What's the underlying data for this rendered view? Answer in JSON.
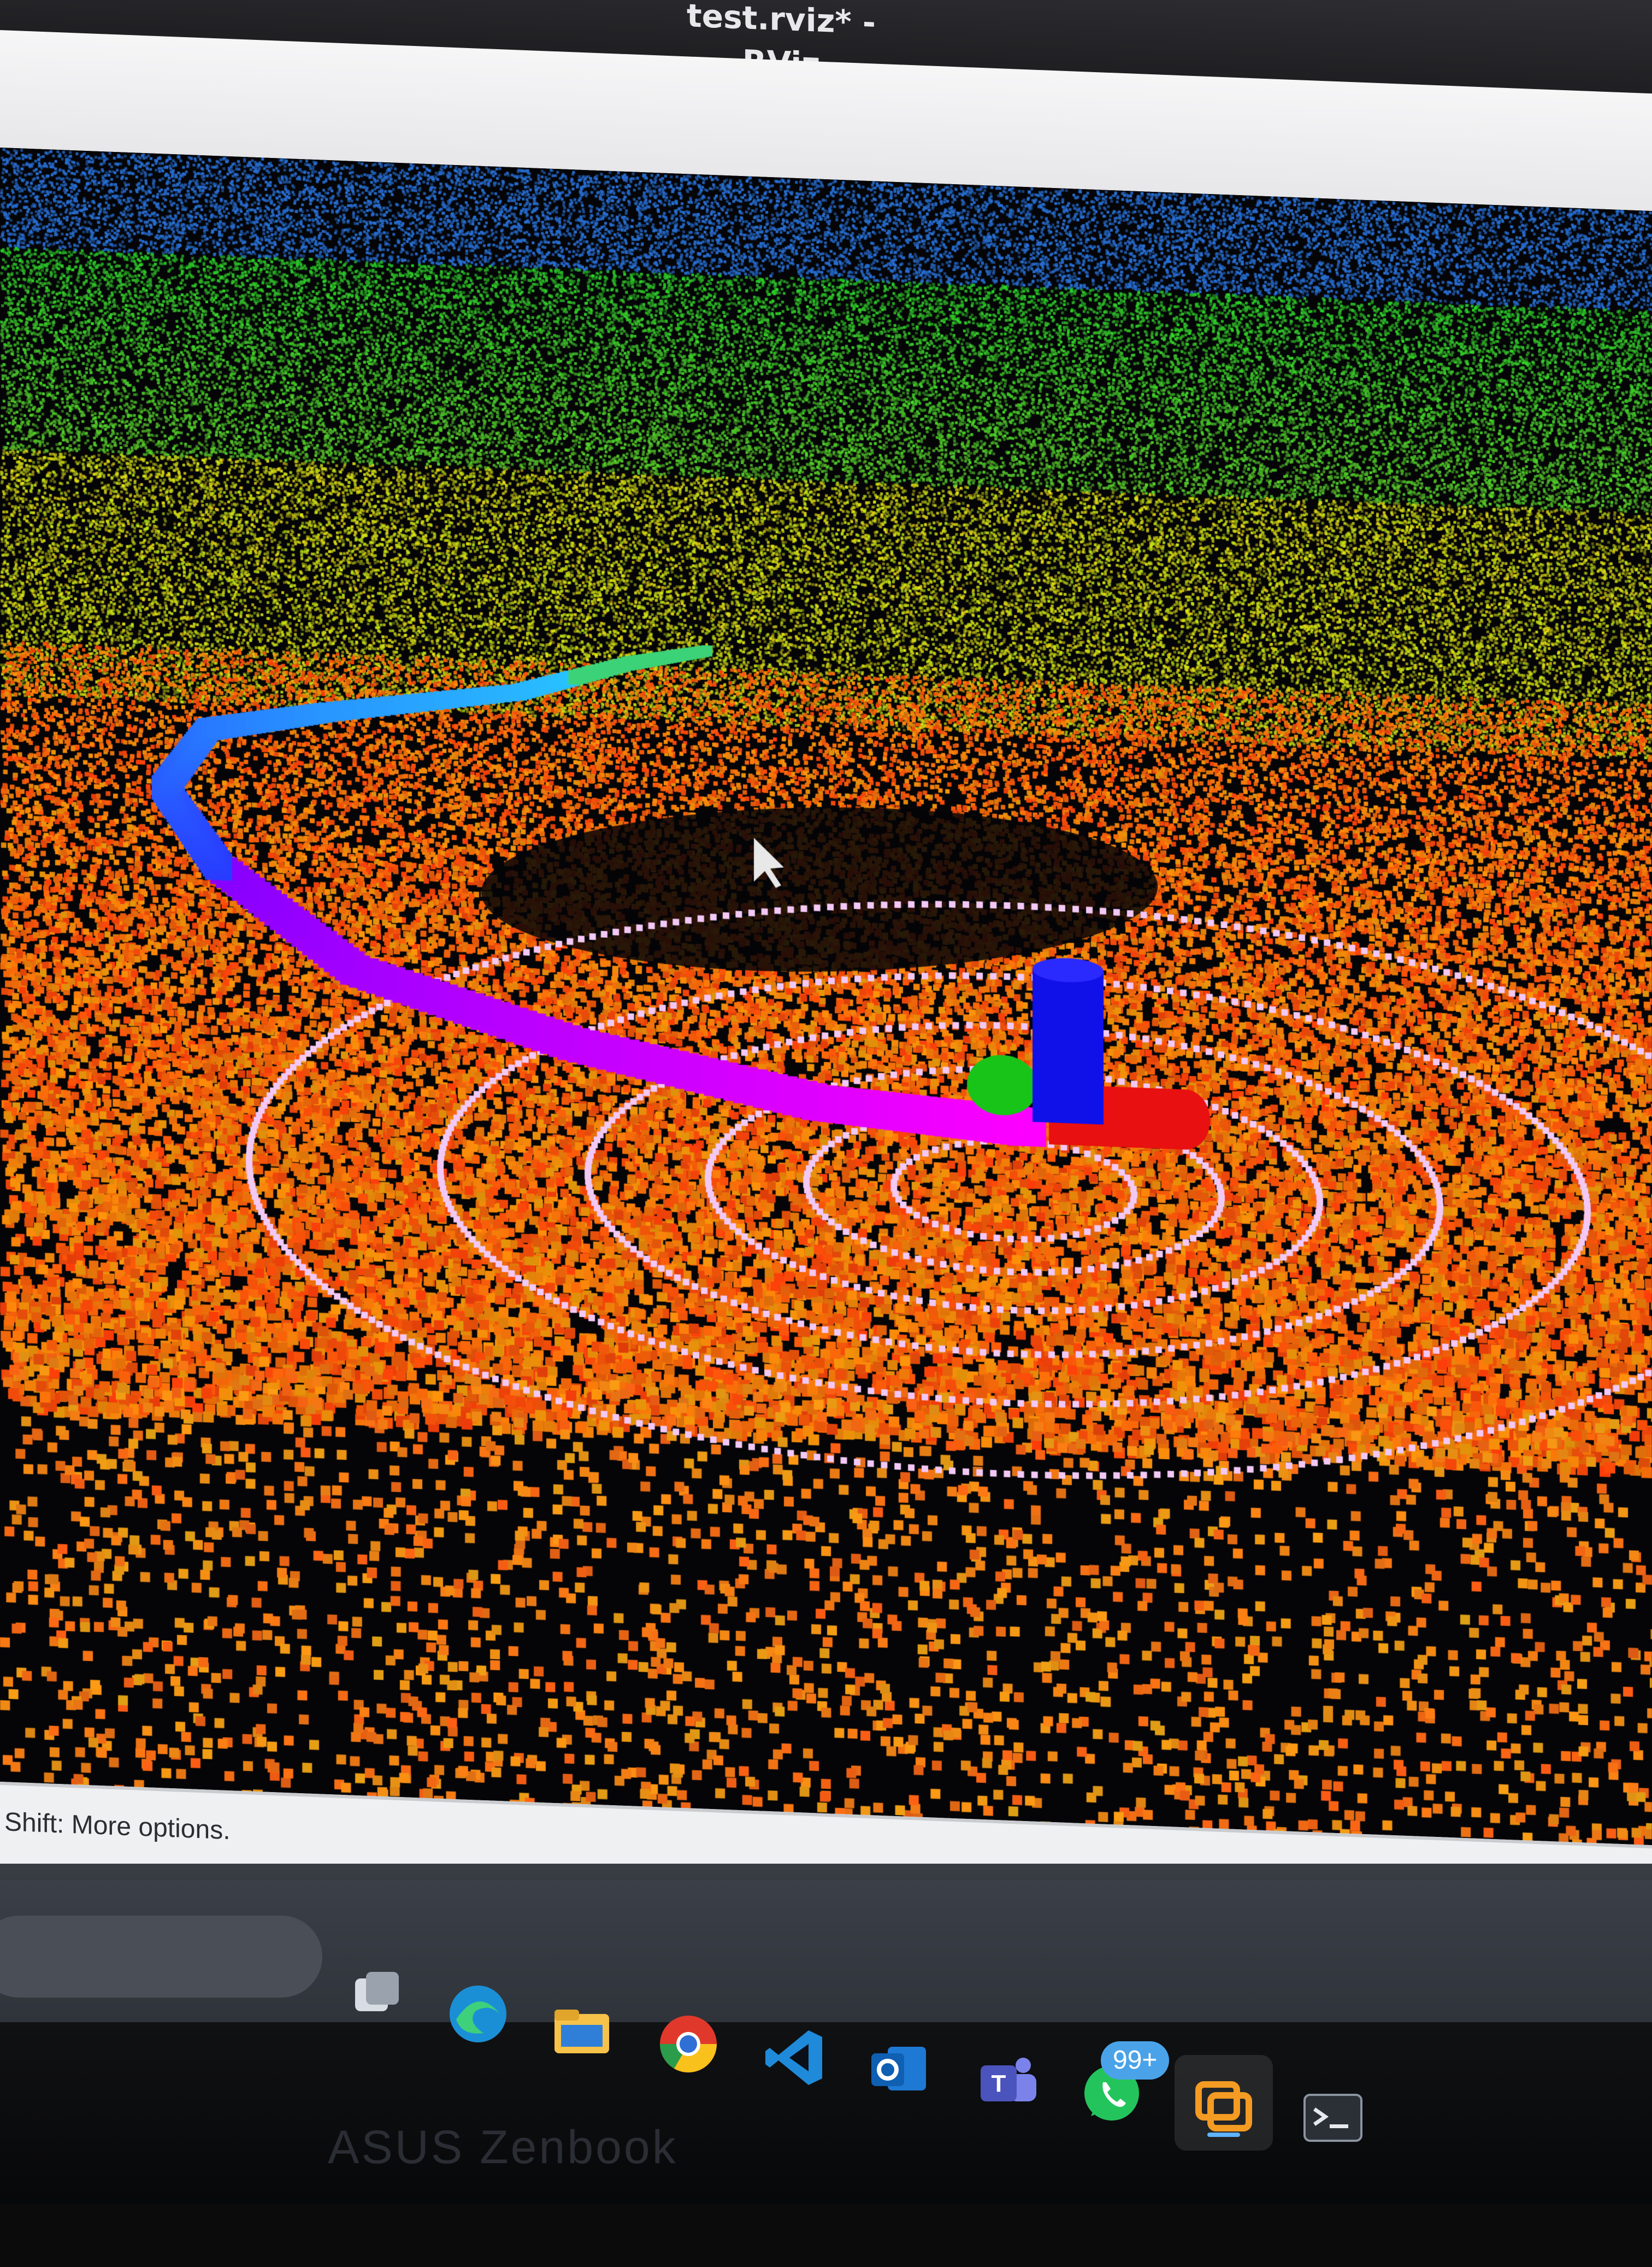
{
  "window": {
    "title": "test.rviz* - RViz"
  },
  "statusbar": {
    "text": "Shift: More options."
  },
  "taskbar": {
    "icons": [
      {
        "name": "task-view-icon"
      },
      {
        "name": "edge-icon"
      },
      {
        "name": "file-explorer-icon"
      },
      {
        "name": "chrome-icon"
      },
      {
        "name": "vscode-icon"
      },
      {
        "name": "outlook-icon"
      },
      {
        "name": "teams-icon"
      },
      {
        "name": "whatsapp-icon"
      },
      {
        "name": "vnc-viewer-icon"
      },
      {
        "name": "terminal-icon"
      }
    ],
    "whatsapp_badge": "99+"
  },
  "monitor": {
    "brand": "ASUS Zenbook"
  },
  "scene": {
    "description_colors": {
      "path_start": "#ff00ff",
      "path_mid": "#8a00ff",
      "path_end": "#1a6cff",
      "axis_x": "#e81010",
      "axis_y": "#18c418",
      "axis_z": "#1010e8",
      "ring_points": "#f2c8f5"
    }
  }
}
